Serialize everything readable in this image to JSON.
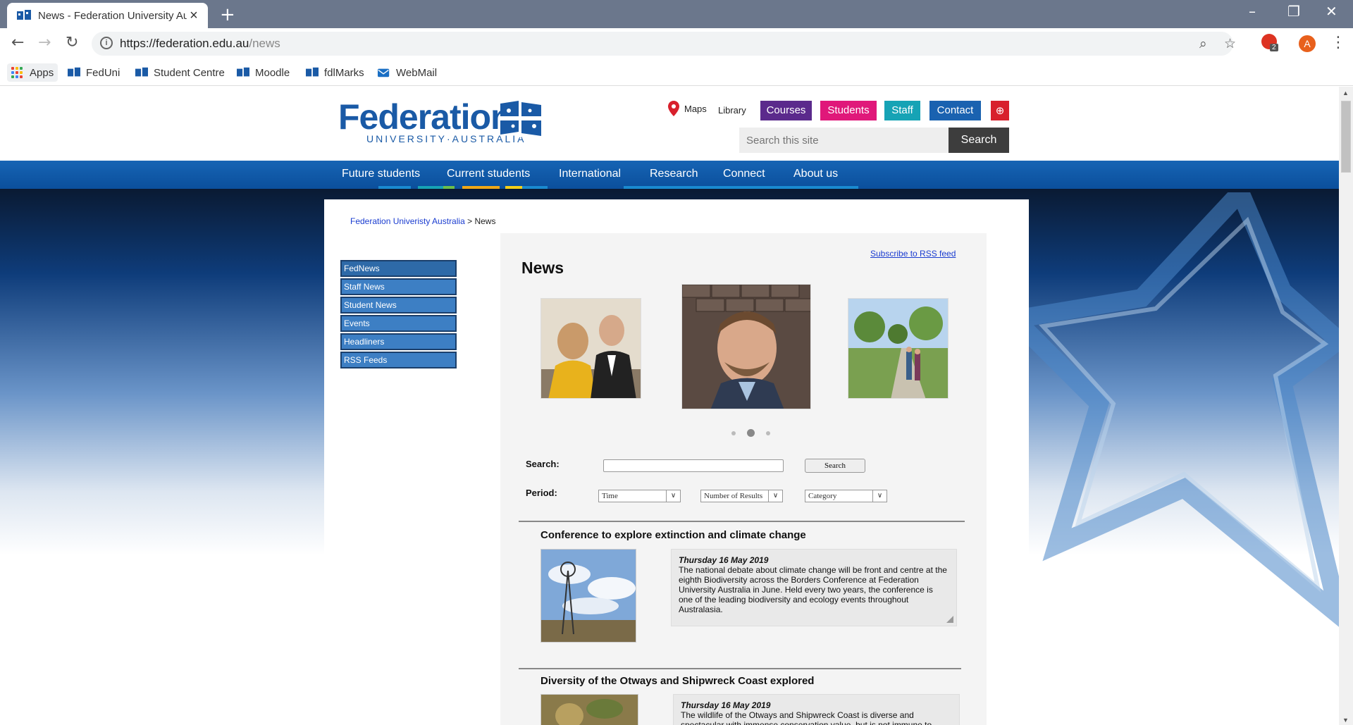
{
  "browser": {
    "tab_title": "News - Federation University Aus",
    "url_host": "https://federation.edu.au",
    "url_path": "/news",
    "new_tab": "+",
    "profile_initial": "A",
    "extension_badge": "2",
    "bookmarks": [
      "Apps",
      "FedUni",
      "Student Centre",
      "Moodle",
      "fdlMarks",
      "WebMail"
    ]
  },
  "header": {
    "logo_word": "Federation",
    "logo_sub": "UNIVERSITY·AUSTRALIA",
    "util_links": [
      "Maps",
      "Library"
    ],
    "pills": [
      {
        "label": "Courses",
        "color": "#5b2a8c"
      },
      {
        "label": "Students",
        "color": "#e0187a"
      },
      {
        "label": "Staff",
        "color": "#16a3b5"
      },
      {
        "label": "Contact",
        "color": "#1a62b0"
      }
    ],
    "search_placeholder": "Search this site",
    "search_button": "Search"
  },
  "mainnav": [
    "Future students",
    "Current students",
    "International",
    "Research",
    "Connect",
    "About us"
  ],
  "breadcrumb": {
    "root": "Federation Univeristy Australia",
    "sep": ">",
    "current": "News"
  },
  "sidenav": [
    "FedNews",
    "Staff News",
    "Student News",
    "Events",
    "Headliners",
    "RSS Feeds"
  ],
  "news": {
    "rss_link": "Subscribe to RSS feed",
    "heading": "News",
    "carousel_active": 2,
    "search_label": "Search:",
    "search_button": "Search",
    "period_label": "Period:",
    "filters": [
      "Time",
      "Number of Results",
      "Category"
    ],
    "articles": [
      {
        "title": "Conference to explore extinction and climate change",
        "date": "Thursday 16 May 2019",
        "summary": "The national debate about climate change will be front and centre at the eighth Biodiversity across the Borders Conference at Federation University Australia in June. Held every two years, the conference is one of the leading biodiversity and ecology events throughout Australasia."
      },
      {
        "title": "Diversity of the Otways and Shipwreck Coast explored",
        "date": "Thursday 16 May 2019",
        "summary": "The wildlife of the Otways and Shipwreck Coast is diverse and spectacular with immense conservation value, but is not immune to"
      }
    ]
  }
}
